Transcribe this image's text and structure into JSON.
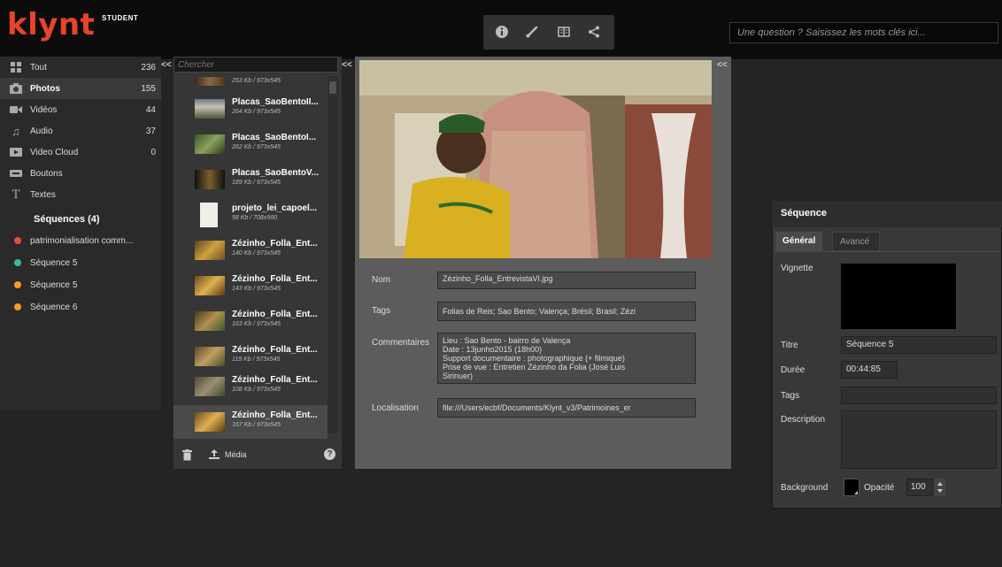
{
  "app": {
    "logo": "klynt",
    "logo_badge": "STUDENT"
  },
  "toolbar": {
    "icons": [
      "info-icon",
      "brush-icon",
      "book-icon",
      "share-icon"
    ]
  },
  "search": {
    "placeholder": "Une question ? Saisissez les mots clés ici..."
  },
  "sidebar": {
    "collapse": "<<",
    "items": [
      {
        "label": "Tout",
        "count": "236",
        "icon": "grid-icon"
      },
      {
        "label": "Photos",
        "count": "155",
        "icon": "camera-icon"
      },
      {
        "label": "Vidéos",
        "count": "44",
        "icon": "video-icon"
      },
      {
        "label": "Audio",
        "count": "37",
        "icon": "music-icon"
      },
      {
        "label": "Video Cloud",
        "count": "0",
        "icon": "cloud-video-icon"
      },
      {
        "label": "Boutons",
        "count": "",
        "icon": "button-icon"
      },
      {
        "label": "Textes",
        "count": "",
        "icon": "text-icon"
      }
    ],
    "sequences_heading": "Séquences (4)",
    "sequences": [
      {
        "label": "patrimonialisation comm...",
        "color": "#e74c3c"
      },
      {
        "label": "Séquence 5",
        "color": "#3cb8a0"
      },
      {
        "label": "Séquence 5",
        "color": "#f0a020"
      },
      {
        "label": "Séquence 6",
        "color": "#f0a020"
      }
    ]
  },
  "media_list": {
    "search_placeholder": "Chercher",
    "collapse": "<<",
    "items": [
      {
        "name": "",
        "meta": "253 Kb / 973x545"
      },
      {
        "name": "Placas_SaoBentoII...",
        "meta": "264 Kb / 973x545"
      },
      {
        "name": "Placas_SaoBentoI...",
        "meta": "262 Kb / 973x545"
      },
      {
        "name": "Placas_SaoBentoV...",
        "meta": "189 Kb / 973x545"
      },
      {
        "name": "projeto_lei_capoel...",
        "meta": "58 Kb / 708x960"
      },
      {
        "name": "Zézinho_Folla_Ent...",
        "meta": "140 Kb / 973x545"
      },
      {
        "name": "Zézinho_Folla_Ent...",
        "meta": "143 Kb / 973x545"
      },
      {
        "name": "Zézinho_Folla_Ent...",
        "meta": "163 Kb / 973x545"
      },
      {
        "name": "Zézinho_Folla_Ent...",
        "meta": "119 Kb / 973x545"
      },
      {
        "name": "Zézinho_Folla_Ent...",
        "meta": "108 Kb / 973x545"
      },
      {
        "name": "Zézinho_Folla_Ent...",
        "meta": "167 Kb / 973x545"
      }
    ],
    "footer_media": "Média"
  },
  "detail": {
    "collapse": "<<",
    "nom_label": "Nom",
    "nom_value": "Zézinho_Folla_EntrevistaVI.jpg",
    "tags_label": "Tags",
    "tags_value": "Folias de Reis; Sao Bento; Valença; Brésil; Brasil; Zézi",
    "comment_label": "Commentaires",
    "comment_lines": [
      "Lieu : Sao Bento - bairro de Valença",
      "Date : 13junho2015 (18h00)",
      "Support documentaire : photographique (+ filmique)",
      "Prise de vue : Entretien Zézinho da Folia (José Luis",
      "Sirinuer)"
    ],
    "loc_label": "Localisation",
    "loc_value": "file:///Users/ecbf/Documents/Klynt_v3/Patrimoines_er"
  },
  "sequence_panel": {
    "title": "Séquence",
    "tabs": [
      "Général",
      "Avancé"
    ],
    "vignette_label": "Vignette",
    "titre_label": "Titre",
    "titre_value": "Séquence 5",
    "duree_label": "Durée",
    "duree_value": "00:44:85",
    "tags_label": "Tags",
    "tags_value": "",
    "description_label": "Description",
    "description_value": "",
    "background_label": "Background",
    "opacite_label": "Opacité",
    "opacite_value": "100"
  }
}
